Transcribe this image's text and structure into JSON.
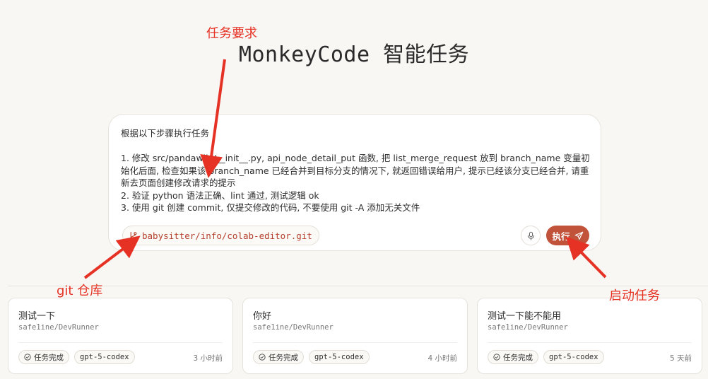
{
  "header": {
    "title": "MonkeyCode 智能任务"
  },
  "task_input": {
    "text": "根据以下步骤执行任务\n\n1. 修改 src/pandawiki/__init__.py, api_node_detail_put 函数, 把 list_merge_request 放到 branch_name 变量初始化后面, 检查如果该 branch_name 已经合并到目标分支的情况下, 就返回错误给用户, 提示已经该分支已经合并, 请重新去页面创建修改请求的提示\n2. 验证 python 语法正确、lint 通过, 测试逻辑 ok\n3. 使用 git 创建 commit, 仅提交修改的代码, 不要使用 git -A 添加无关文件",
    "repo": "babysitter/info/colab-editor.git",
    "run_label": "执行",
    "repo_icon": "git-branch-icon",
    "mic_icon": "microphone-icon",
    "send_icon": "send-icon"
  },
  "history": [
    {
      "title": "测试一下",
      "repo": "safe1ine/DevRunner",
      "status": "任务完成",
      "model": "gpt-5-codex",
      "time": "3 小时前"
    },
    {
      "title": "你好",
      "repo": "safe1ine/DevRunner",
      "status": "任务完成",
      "model": "gpt-5-codex",
      "time": "4 小时前"
    },
    {
      "title": "测试一下能不能用",
      "repo": "safe1ine/DevRunner",
      "status": "任务完成",
      "model": "gpt-5-codex",
      "time": "5 天前"
    }
  ],
  "annotations": {
    "requirement": "任务要求",
    "repo": "git 仓库",
    "start": "启动任务"
  },
  "colors": {
    "accent": "#c0533a",
    "repo_text": "#b5412c",
    "annotation": "#e53225",
    "background": "#f9f7f3"
  }
}
